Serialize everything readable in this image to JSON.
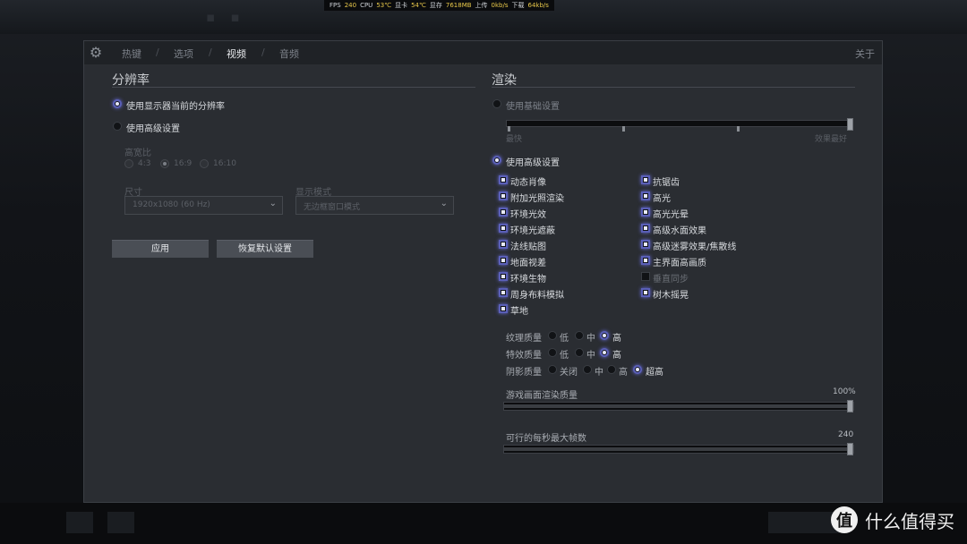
{
  "osd": {
    "fps_label": "FPS",
    "fps": "240",
    "cpu_label": "CPU",
    "cpu": "53℃",
    "gpu_label": "显卡",
    "gpu": "54℃",
    "vram_label": "显存",
    "vram": "7618MB",
    "up_label": "上传",
    "up": "0kb/s",
    "down_label": "下载",
    "down": "64kb/s"
  },
  "tabs": [
    "热键",
    "选项",
    "视频",
    "音频"
  ],
  "about": "关于",
  "resolution": {
    "title": "分辨率",
    "use_current": "使用显示器当前的分辨率",
    "use_advanced": "使用高级设置",
    "aspect_label": "高宽比",
    "aspects": [
      "4:3",
      "16:9",
      "16:10"
    ],
    "size_label": "尺寸",
    "size_value": "1920x1080 (60 Hz)",
    "mode_label": "显示模式",
    "mode_value": "无边框窗口模式",
    "apply": "应用",
    "reset": "恢复默认设置"
  },
  "render": {
    "title": "渲染",
    "basic": "使用基础设置",
    "slider_low": "最快",
    "slider_high": "效果最好",
    "advanced": "使用高级设置",
    "left_checks": [
      "动态肖像",
      "附加光照渲染",
      "环境光效",
      "环境光遮蔽",
      "法线贴图",
      "地面视差",
      "环境生物",
      "周身布料模拟",
      "草地"
    ],
    "right_checks": [
      "抗锯齿",
      "高光",
      "高光光晕",
      "高级水面效果",
      "高级迷雾效果/焦散线",
      "主界面高画质",
      "垂直同步",
      "树木摇晃"
    ],
    "right_checked": [
      true,
      true,
      true,
      true,
      true,
      true,
      false,
      true
    ],
    "texture": {
      "label": "纹理质量",
      "opts": [
        "低",
        "中",
        "高"
      ]
    },
    "effects": {
      "label": "特效质量",
      "opts": [
        "低",
        "中",
        "高"
      ]
    },
    "shadow": {
      "label": "阴影质量",
      "opts": [
        "关闭",
        "中",
        "高",
        "超高"
      ]
    },
    "render_quality": {
      "label": "游戏画面渲染质量",
      "value": "100%",
      "level": 1.0
    },
    "max_fps": {
      "label": "可行的每秒最大帧数",
      "value": "240",
      "level": 1.0
    }
  },
  "watermark": {
    "logo": "值",
    "text": "什么值得买"
  }
}
